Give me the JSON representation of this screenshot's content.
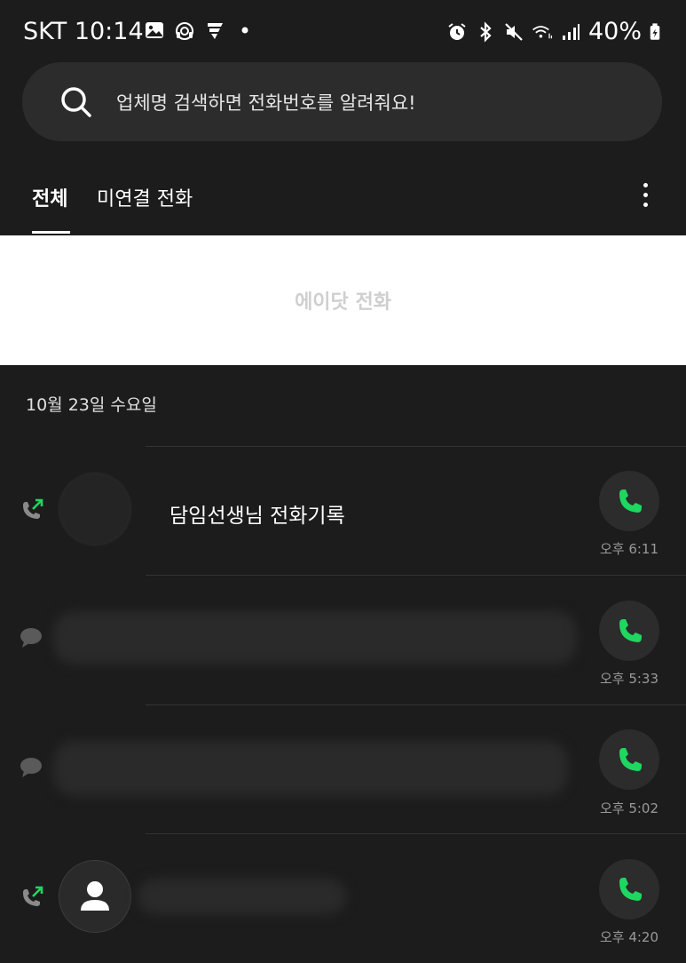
{
  "status_bar": {
    "carrier_time": "SKT 10:14",
    "battery": "40%",
    "left_icons": [
      "gallery-icon",
      "headset-icon",
      "flash-app-icon",
      "dot-icon"
    ],
    "right_icons": [
      "alarm-icon",
      "bluetooth-icon",
      "mute-icon",
      "wifi-icon",
      "signal-icon",
      "battery-icon"
    ]
  },
  "search": {
    "placeholder": "업체명 검색하면 전화번호를 알려줘요!"
  },
  "tabs": [
    {
      "label": "전체",
      "active": true
    },
    {
      "label": "미연결 전화",
      "active": false
    }
  ],
  "banner": {
    "text": "에이닷 전화"
  },
  "date_header": "10월 23일 수요일",
  "calls": [
    {
      "type": "outgoing-call",
      "name": "담임선생님 전화기록",
      "time": "오후 6:11"
    },
    {
      "type": "message",
      "name": "",
      "time": "오후 5:33"
    },
    {
      "type": "message",
      "name": "",
      "time": "오후 5:02"
    },
    {
      "type": "outgoing-call",
      "name": "",
      "time": "오후 4:20"
    }
  ],
  "colors": {
    "background": "#1c1c1c",
    "accent_green": "#1ed760",
    "surface": "#2c2c2c"
  }
}
